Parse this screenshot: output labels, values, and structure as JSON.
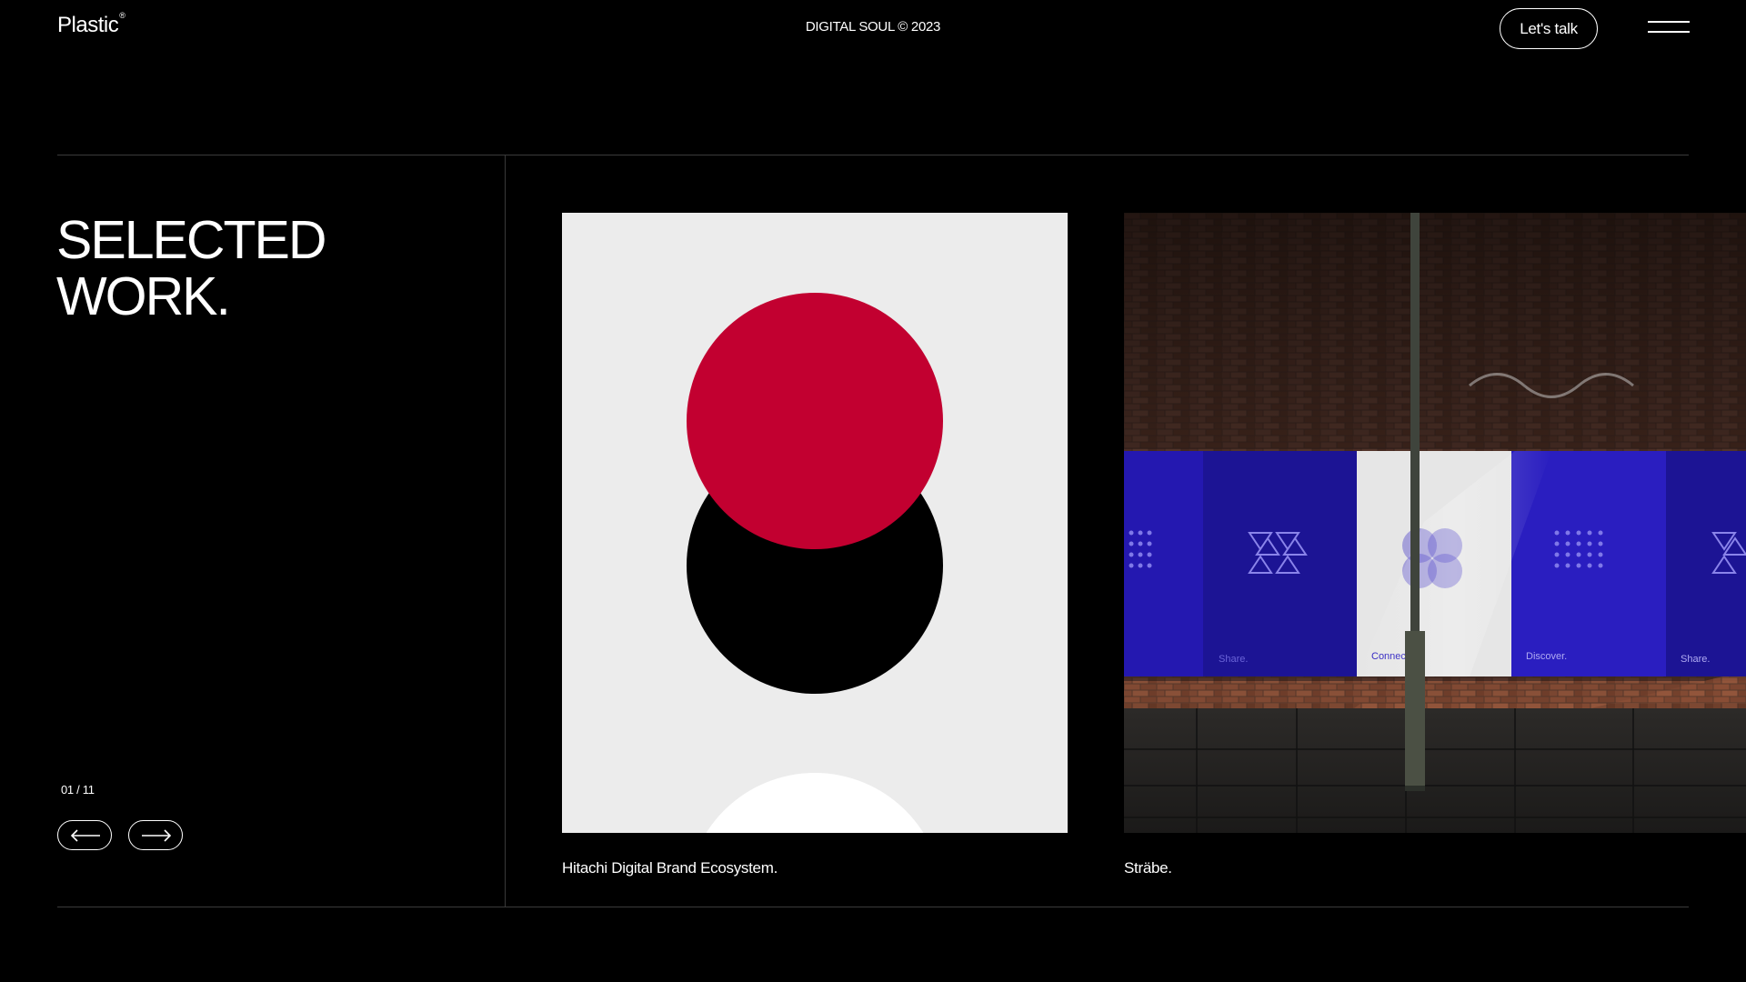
{
  "header": {
    "logo": "Plastic",
    "logo_mark": "®",
    "tagline": "DIGITAL SOUL © 2023",
    "cta_label": "Let's talk",
    "menu_icon": "hamburger-menu-icon"
  },
  "section": {
    "title_line1": "SELECTED",
    "title_line2": "WORK.",
    "counter": "01 / 11"
  },
  "nav": {
    "prev_icon": "arrow-left-icon",
    "next_icon": "arrow-right-icon"
  },
  "projects": [
    {
      "caption": "Hitachi Digital Brand Ecosystem."
    },
    {
      "caption": "Sträbe.",
      "poster_labels": [
        "Share.",
        "Connect.",
        "Discover.",
        "Share."
      ]
    }
  ],
  "colors": {
    "background": "#000000",
    "text": "#ffffff",
    "hitachi_red": "#c20030",
    "poster_blue": "#2a1ec0"
  }
}
